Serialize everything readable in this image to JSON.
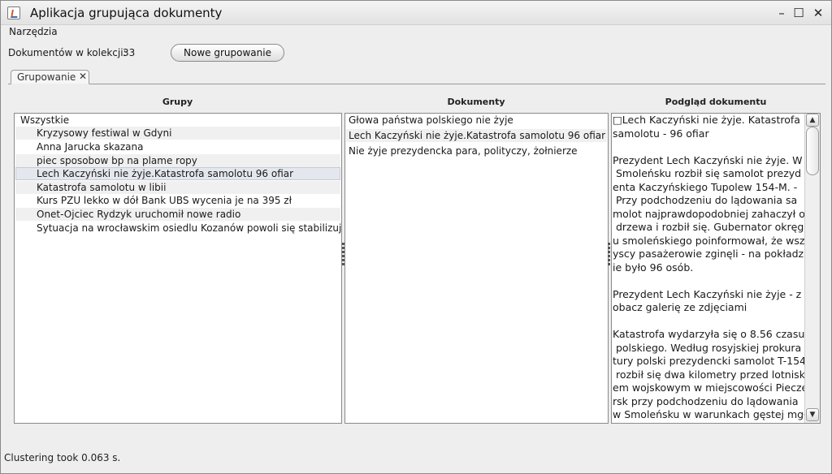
{
  "window": {
    "title": "Aplikacja grupująca dokumenty",
    "controls": {
      "minimize": "–",
      "maximize": "☐",
      "close": "✕"
    }
  },
  "menu": {
    "items": [
      "Narzędzia"
    ]
  },
  "toolbar": {
    "doc_count_label": "Dokumentów w kolekcji:",
    "doc_count_value": "33",
    "new_grouping_label": "Nowe grupowanie"
  },
  "tabs": [
    {
      "label": "Grupowanie",
      "close": "✕"
    }
  ],
  "columns": {
    "groups_header": "Grupy",
    "documents_header": "Dokumenty",
    "preview_header": "Podgląd dokumentu"
  },
  "groups": {
    "root": "Wszystkie",
    "items": [
      "Kryzysowy festiwal w Gdyni",
      "Anna Jarucka skazana",
      "piec sposobow bp na plame ropy",
      "Lech Kaczyński nie żyje.Katastrofa samolotu 96 ofiar",
      "Katastrofa samolotu w libii",
      "Kurs PZU lekko w dół Bank UBS wycenia je na 395 zł",
      "Onet-Ojciec Rydzyk uruchomił nowe radio",
      "Sytuacja na wrocławskim osiedlu Kozanów powoli się stabilizuje"
    ],
    "selected_index": 3
  },
  "documents": {
    "items": [
      "Głowa państwa polskiego nie żyje",
      "Lech Kaczyński nie żyje.Katastrofa samolotu 96 ofiar",
      "Nie żyje prezydencka para, polityczy, żołnierze"
    ]
  },
  "preview": {
    "text": "□Lech Kaczyński nie żyje. Katastrofa\nsamolotu - 96 ofiar\n\nPrezydent Lech Kaczyński nie żyje. W\n Smoleńsku rozbił się samolot prezyd\nenta Kaczyńskiego Tupolew 154-M. -\n Przy podchodzeniu do lądowania sa\nmolot najprawdopodobniej zahaczył o\n drzewa i rozbił się. Gubernator okręg\nu smoleńskiego poinformował, że wsz\nyscy pasażerowie zginęli - na pokładz\nie było 96 osób.\n\nPrezydent Lech Kaczyński nie żyje - z\nobacz galerię ze zdjęciami\n\nKatastrofa wydarzyła się o 8.56 czasu\n polskiego. Według rosyjskiej prokura\ntury polski prezydencki samolot T-154\n rozbił się dwa kilometry przed lotnisk\nem wojskowym w miejscowości Piecze\nrsk przy podchodzeniu do lądowania\nw Smoleńsku w warunkach gęstej mgł",
    "scroll_up": "▲",
    "scroll_down": "▼"
  },
  "status": {
    "text": "Clustering took 0.063 s."
  },
  "colors": {
    "background": "#eeeeee",
    "selection": "#e4e8ee",
    "border": "#8a8a8a"
  }
}
